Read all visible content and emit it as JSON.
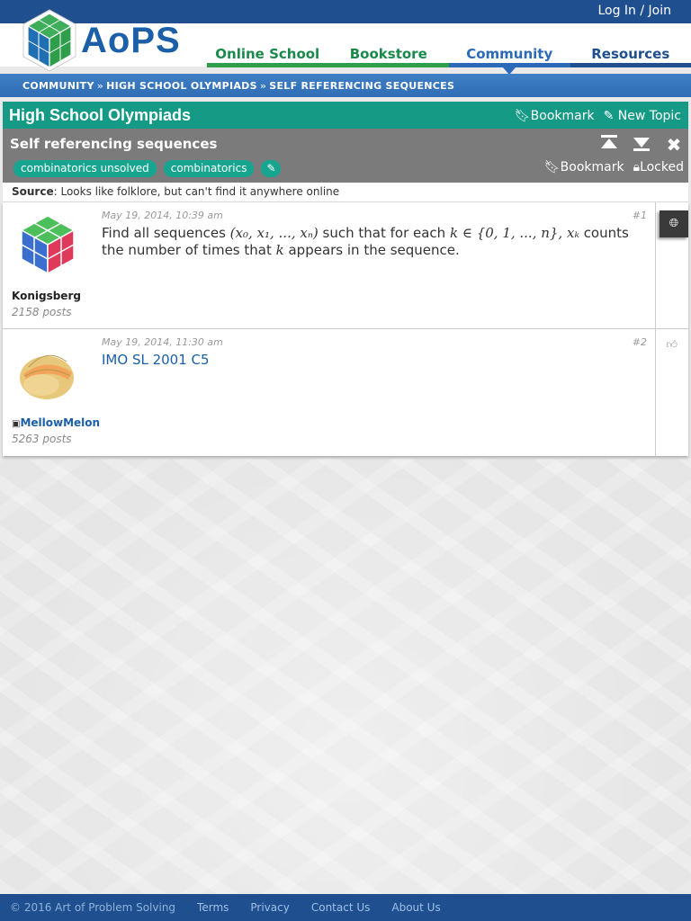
{
  "topbar": {
    "login_label": "Log In / Join"
  },
  "logo": {
    "text": "AoPS",
    "icon": "aops-cube-logo"
  },
  "nav": {
    "items": [
      {
        "label": "Online School"
      },
      {
        "label": "Bookstore"
      },
      {
        "label": "Community"
      },
      {
        "label": "Resources"
      }
    ],
    "active": "Community"
  },
  "breadcrumb": {
    "items": [
      "COMMUNITY",
      "HIGH SCHOOL OLYMPIADS",
      "SELF REFERENCING SEQUENCES"
    ],
    "separator": "»"
  },
  "forum": {
    "title": "High School Olympiads",
    "bookmark_label": "Bookmark",
    "new_topic_label": "New Topic",
    "bookmark_icon": "bookmark-icon",
    "new_topic_icon": "edit-icon"
  },
  "topic": {
    "title": "Self referencing sequences",
    "tags": [
      "combinatorics unsolved",
      "combinatorics"
    ],
    "tag_edit_icon": "pencil-icon",
    "bookmark_label": "Bookmark",
    "locked_label": "Locked",
    "icons": [
      "jump-to-top-icon",
      "jump-to-bottom-icon",
      "close-icon"
    ]
  },
  "source": {
    "label": "Source",
    "text": ": Looks like folklore, but can't find it anywhere online"
  },
  "posts": [
    {
      "date": "May 19, 2014, 10:39 am",
      "number": "#1",
      "username": "Konigsberg",
      "postcount": "2158 posts",
      "body": {
        "t1": "Find all sequences ",
        "m1": "(x₀, x₁, ..., xₙ)",
        "t2": " such that for each ",
        "m2": "k ∈ {0, 1, ..., n}, xₖ",
        "t3": " counts the number of times that ",
        "m3": "k",
        "t4": " appears in the sequence."
      },
      "side_icon": "globe-icon"
    },
    {
      "date": "May 19, 2014, 11:30 am",
      "number": "#2",
      "username": "MellowMelon",
      "postcount": "5263 posts",
      "body_link": "IMO SL 2001 C5",
      "side_icon": "thumbs-up-icon"
    }
  ],
  "footer": {
    "copyright": "© 2016 Art of Problem Solving",
    "links": [
      "Terms",
      "Privacy",
      "Contact Us",
      "About Us"
    ]
  },
  "colors": {
    "brand_blue": "#1f4f8f",
    "forum_teal": "#159a86",
    "topic_gray": "#7b7b7b",
    "nav_green": "#2e9e4a"
  }
}
